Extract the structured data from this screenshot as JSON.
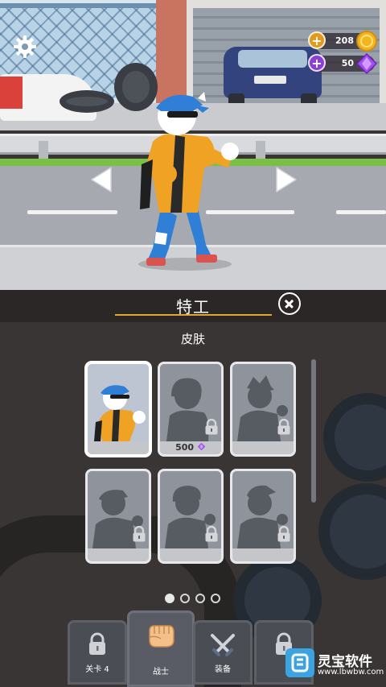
{
  "currency": {
    "coins": "208",
    "gems": "50",
    "coin_color": "#f2b51f",
    "gem_color": "#8b3ed8"
  },
  "icons": {
    "settings": "gear-icon",
    "prev": "arrow-left-icon",
    "next": "arrow-right-icon",
    "close": "close-icon",
    "lock": "lock-icon",
    "gem": "gem-icon",
    "coin": "coin-icon",
    "fist": "fist-icon",
    "swords": "swords-icon"
  },
  "panel": {
    "title": "特工",
    "subtitle": "皮肤",
    "accent": "#e6a531"
  },
  "skins": [
    {
      "id": "skin-1",
      "selected": true,
      "locked": false,
      "price": ""
    },
    {
      "id": "skin-2",
      "selected": false,
      "locked": true,
      "price": "500"
    },
    {
      "id": "skin-3",
      "selected": false,
      "locked": true,
      "price": ""
    },
    {
      "id": "skin-4",
      "selected": false,
      "locked": true,
      "price": ""
    },
    {
      "id": "skin-5",
      "selected": false,
      "locked": true,
      "price": ""
    },
    {
      "id": "skin-6",
      "selected": false,
      "locked": true,
      "price": ""
    }
  ],
  "pagination": {
    "pages": 4,
    "current": 1
  },
  "bottom_nav": [
    {
      "label": "关卡 4",
      "icon": "lock-icon",
      "active": false
    },
    {
      "label": "战士",
      "icon": "fist-icon",
      "active": true
    },
    {
      "label": "装备",
      "icon": "swords-icon",
      "active": false
    },
    {
      "label": "",
      "icon": "lock-icon",
      "active": false
    }
  ],
  "watermark": {
    "text": "灵宝软件",
    "url": "www.lbwbw.com"
  }
}
